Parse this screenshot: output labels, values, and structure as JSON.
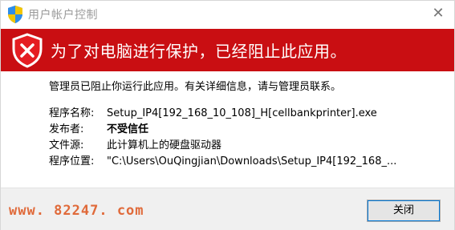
{
  "window": {
    "title": "用户帐户控制"
  },
  "banner": {
    "heading": "为了对电脑进行保护，已经阻止此应用。"
  },
  "content": {
    "message": "管理员已阻止你运行此应用。有关详细信息，请与管理员联系。",
    "fields": [
      {
        "label": "程序名称:",
        "value": "Setup_IP4[192_168_10_108]_H[cellbankprinter].exe"
      },
      {
        "label": "发布者:",
        "value": "不受信任"
      },
      {
        "label": "文件源:",
        "value": "此计算机上的硬盘驱动器"
      },
      {
        "label": "程序位置:",
        "value": "\"C:\\Users\\OuQingjian\\Downloads\\Setup_IP4[192_168_..."
      }
    ]
  },
  "footer": {
    "watermark": "www. 82247. com",
    "close_button": "关闭"
  },
  "icons": {
    "title": "uac-shield-icon",
    "banner": "blocked-shield-icon",
    "close": "close-icon"
  },
  "colors": {
    "banner": "#c90e12",
    "watermark": "#e06a3a"
  }
}
